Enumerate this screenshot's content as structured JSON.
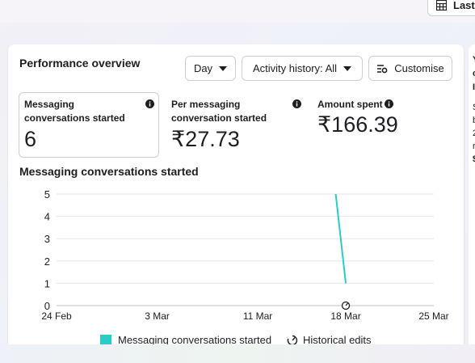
{
  "header": {
    "last_button_label": "Last"
  },
  "card": {
    "title": "Performance overview",
    "day_dropdown": "Day",
    "activity_dropdown": "Activity history: All",
    "customise_button": "Customise"
  },
  "metrics": [
    {
      "label": "Messaging conversations started",
      "value": "6"
    },
    {
      "label": "Per messaging conversation started",
      "value": "₹27.73"
    },
    {
      "label": "Amount spent",
      "value": "₹166.39"
    }
  ],
  "chart_title": "Messaging conversations started",
  "chart_data": {
    "type": "line",
    "title": "Messaging conversations started",
    "x_tick_labels": [
      "24 Feb",
      "3 Mar",
      "11 Mar",
      "18 Mar",
      "25 Mar"
    ],
    "x_domain": [
      "24 Feb",
      "25 Mar"
    ],
    "ylim": [
      0,
      5
    ],
    "y_ticks": [
      0,
      1,
      2,
      3,
      4,
      5
    ],
    "grid": true,
    "series": [
      {
        "name": "Messaging conversations started",
        "color": "#2bcbc6",
        "points": [
          {
            "x": "17 Mar",
            "y": 6
          },
          {
            "x": "18 Mar",
            "y": 1
          }
        ]
      }
    ],
    "annotations": [
      {
        "type": "historical-edit",
        "x": "18 Mar"
      }
    ],
    "legend": [
      "Messaging conversations started",
      "Historical edits"
    ],
    "legend_position": "bottom"
  },
  "right_panel": {
    "letters": [
      "Y",
      "c",
      "I",
      "S",
      "b",
      "2",
      "r",
      "$"
    ]
  }
}
